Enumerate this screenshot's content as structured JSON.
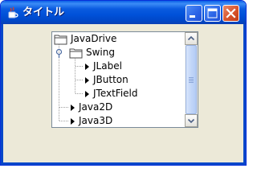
{
  "window": {
    "title": "タイトル",
    "buttons": {
      "minimize": "minimize",
      "maximize": "maximize",
      "close": "close"
    }
  },
  "tree": {
    "root": {
      "label": "JavaDrive",
      "icon": "folder-icon"
    },
    "nodes": [
      {
        "label": "Swing",
        "icon": "folder-icon",
        "expanded": true
      },
      {
        "label": "JLabel",
        "icon": "leaf-arrow-icon"
      },
      {
        "label": "JButton",
        "icon": "leaf-arrow-icon"
      },
      {
        "label": "JTextField",
        "icon": "leaf-arrow-icon"
      },
      {
        "label": "Java2D",
        "icon": "leaf-arrow-icon"
      },
      {
        "label": "Java3D",
        "icon": "leaf-arrow-icon"
      }
    ]
  },
  "colors": {
    "title_bar": "#0a5be0",
    "window_bg": "#ece9d8",
    "close_button": "#d8542c",
    "scroll_thumb": "#c2d6f8"
  }
}
